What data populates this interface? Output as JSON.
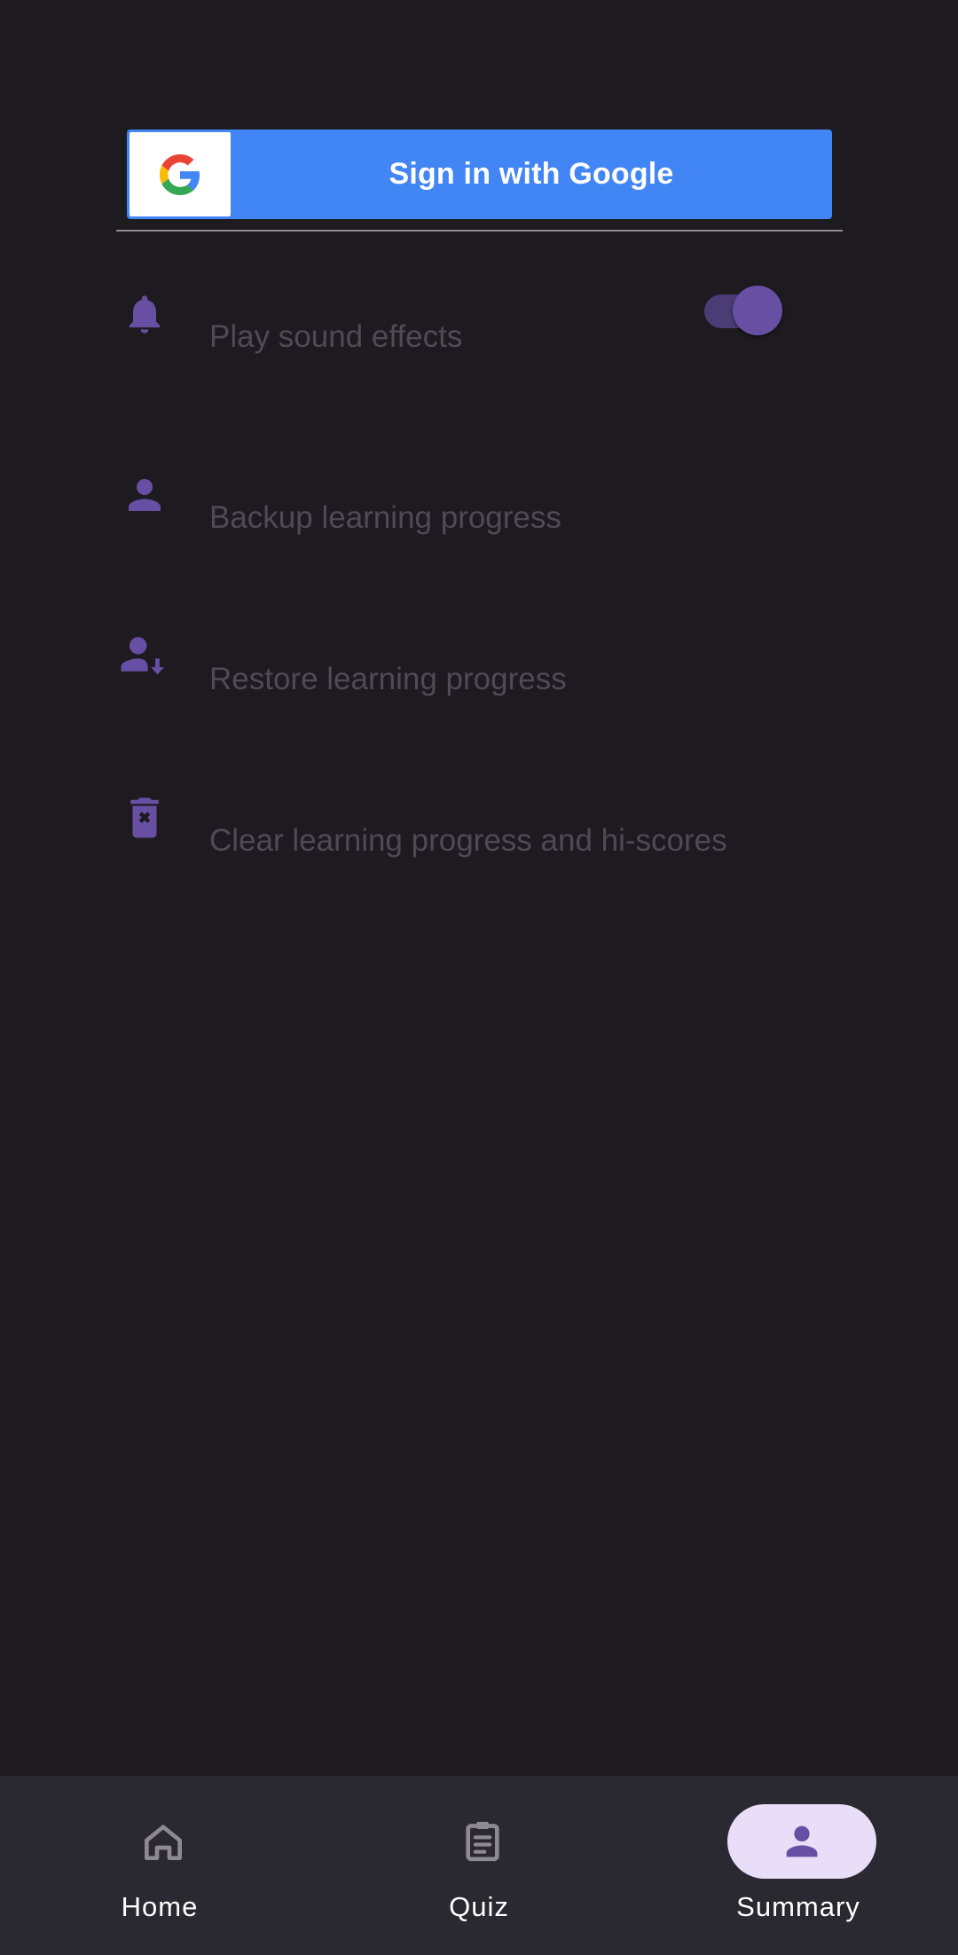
{
  "google_signin": {
    "label": "Sign in with Google",
    "color": "#4285f4"
  },
  "settings": {
    "items": [
      {
        "icon": "bell-icon",
        "label": "Play sound effects",
        "toggle": true,
        "toggle_on": true
      },
      {
        "icon": "person-icon",
        "label": "Backup learning progress"
      },
      {
        "icon": "person-download-icon",
        "label": "Restore learning progress"
      },
      {
        "icon": "trash-x-icon",
        "label": "Clear learning progress and hi-scores"
      }
    ]
  },
  "bottom_nav": {
    "items": [
      {
        "icon": "home-icon",
        "label": "Home",
        "active": false
      },
      {
        "icon": "clipboard-icon",
        "label": "Quiz",
        "active": false
      },
      {
        "icon": "person-icon",
        "label": "Summary",
        "active": true
      }
    ]
  },
  "colors": {
    "background": "#1d1b20",
    "accent": "#6750a4",
    "muted_text": "#4e4b52",
    "nav_background": "#2a2830",
    "active_pill": "#e8def8"
  }
}
